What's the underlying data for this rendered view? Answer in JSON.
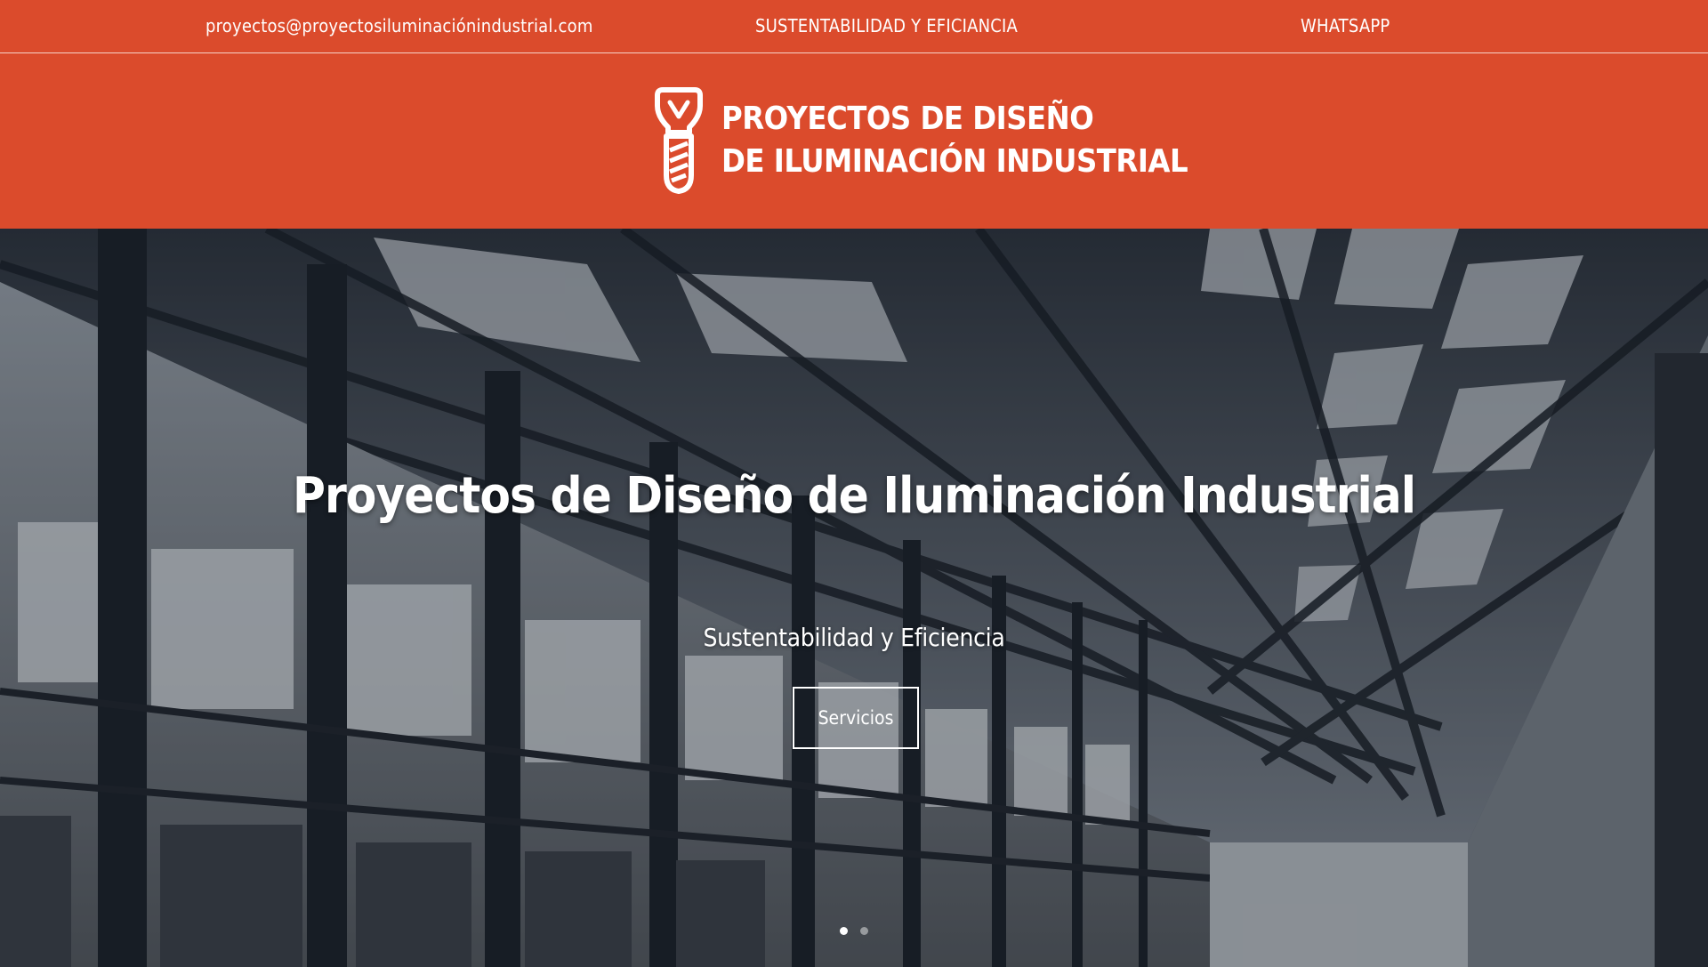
{
  "topbar": {
    "email": "proyectos@proyectosiluminaciónindustrial.com",
    "sustainability_link": "SUSTENTABILIDAD Y EFICIANCIA",
    "whatsapp_link": "WHATSAPP"
  },
  "header": {
    "logo_line1": "PROYECTOS DE DISEÑO",
    "logo_line2": "DE ILUMINACIÓN INDUSTRIAL",
    "logo_icon": "light-bulb-icon"
  },
  "hero": {
    "title": "Proyectos de Diseño de Iluminación Industrial",
    "subtitle": "Sustentabilidad y Eficiencia",
    "button_label": "Servicios",
    "slide_count": 2,
    "active_slide": 1
  },
  "colors": {
    "brand": "#db4b2c",
    "text_light": "#ffffff"
  }
}
